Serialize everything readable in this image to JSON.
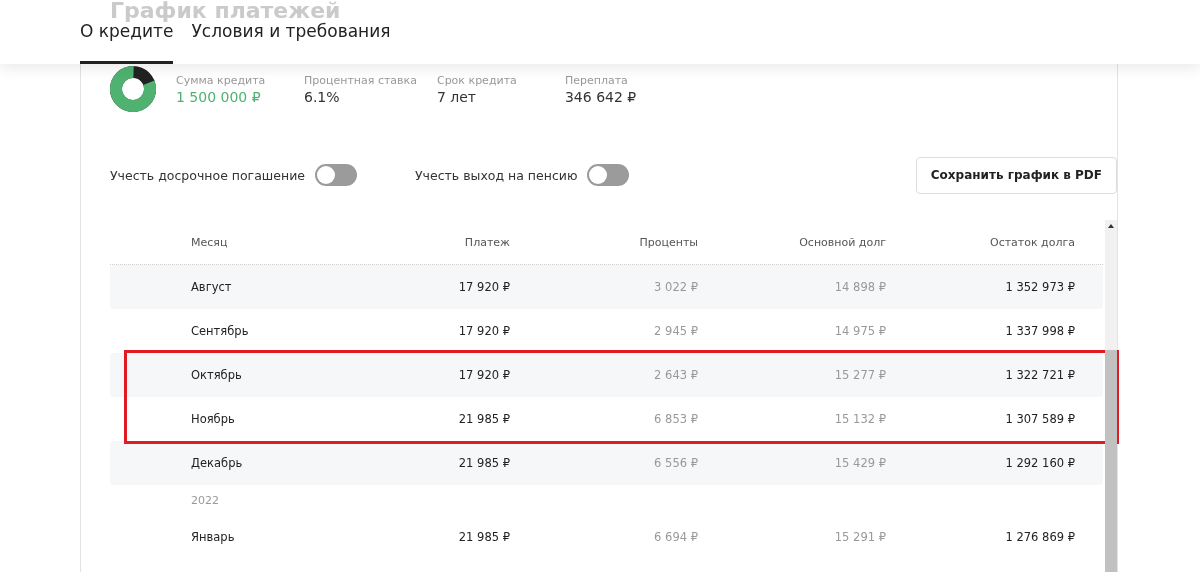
{
  "page_title": "График платежей",
  "tabs": [
    {
      "label": "О кредите",
      "selected": true
    },
    {
      "label": "Условия и требования",
      "selected": false
    }
  ],
  "summary": {
    "stats": [
      {
        "label": "Сумма кредита",
        "value": "1 500 000 ₽",
        "accent": true
      },
      {
        "label": "Процентная ставка",
        "value": "6.1%",
        "accent": false
      },
      {
        "label": "Срок кредита",
        "value": "7 лет",
        "accent": false
      },
      {
        "label": "Переплата",
        "value": "346 642 ₽",
        "accent": false
      }
    ]
  },
  "toggles": [
    {
      "label": "Учесть досрочное погашение",
      "on": false
    },
    {
      "label": "Учесть выход на пенсию",
      "on": false
    }
  ],
  "save_button": "Сохранить график в PDF",
  "table": {
    "columns": [
      "Месяц",
      "Платеж",
      "Проценты",
      "Основной долг",
      "Остаток долга"
    ],
    "rows": [
      {
        "kind": "month",
        "highlighted": false,
        "cells": [
          "Август",
          "17 920 ₽",
          "3 022 ₽",
          "14 898 ₽",
          "1 352 973 ₽"
        ]
      },
      {
        "kind": "month",
        "highlighted": false,
        "cells": [
          "Сентябрь",
          "17 920 ₽",
          "2 945 ₽",
          "14 975 ₽",
          "1 337 998 ₽"
        ]
      },
      {
        "kind": "month",
        "highlighted": true,
        "cells": [
          "Октябрь",
          "17 920 ₽",
          "2 643 ₽",
          "15 277 ₽",
          "1 322 721 ₽"
        ]
      },
      {
        "kind": "month",
        "highlighted": true,
        "cells": [
          "Ноябрь",
          "21 985 ₽",
          "6 853 ₽",
          "15 132 ₽",
          "1 307 589 ₽"
        ]
      },
      {
        "kind": "month",
        "highlighted": false,
        "cells": [
          "Декабрь",
          "21 985 ₽",
          "6 556 ₽",
          "15 429 ₽",
          "1 292 160 ₽"
        ]
      },
      {
        "kind": "year",
        "label": "2022"
      },
      {
        "kind": "month",
        "highlighted": false,
        "cells": [
          "Январь",
          "21 985 ₽",
          "6 694 ₽",
          "15 291 ₽",
          "1 276 869 ₽"
        ]
      }
    ]
  }
}
